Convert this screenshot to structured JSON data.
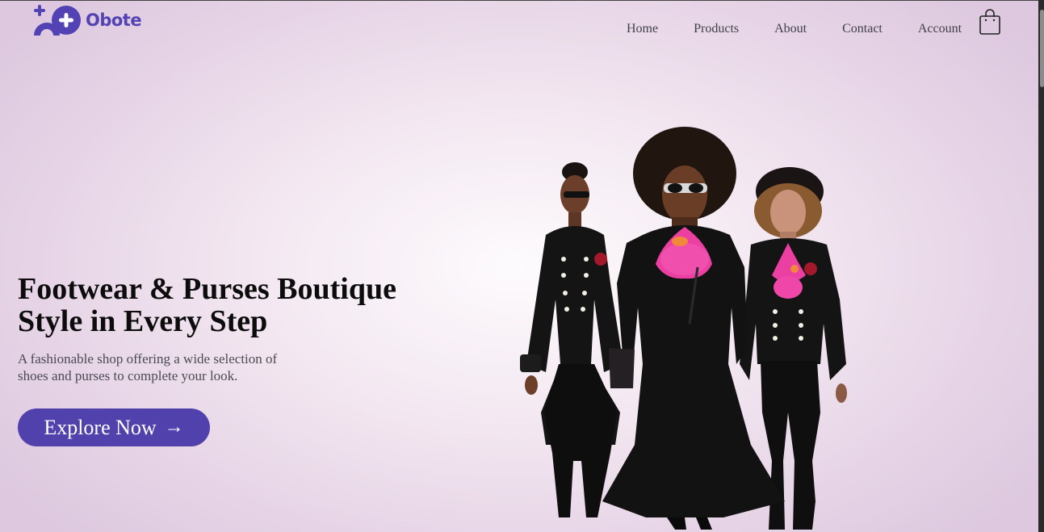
{
  "brand": {
    "name": "Obote",
    "color": "#5242b3"
  },
  "nav": {
    "items": [
      {
        "label": "Home"
      },
      {
        "label": "Products"
      },
      {
        "label": "About"
      },
      {
        "label": "Contact"
      },
      {
        "label": "Account"
      }
    ],
    "cart_icon": "shopping-bag-icon"
  },
  "hero": {
    "title_line1": "Footwear & Purses Boutique",
    "title_line2": "Style in Every Step",
    "subtitle": "A fashionable shop offering a wide selection of shoes and purses to complete your look.",
    "cta_label": "Explore Now",
    "cta_arrow": "→",
    "cta_color": "#5141ad",
    "image": "three-fashion-models-in-black-outfits"
  }
}
